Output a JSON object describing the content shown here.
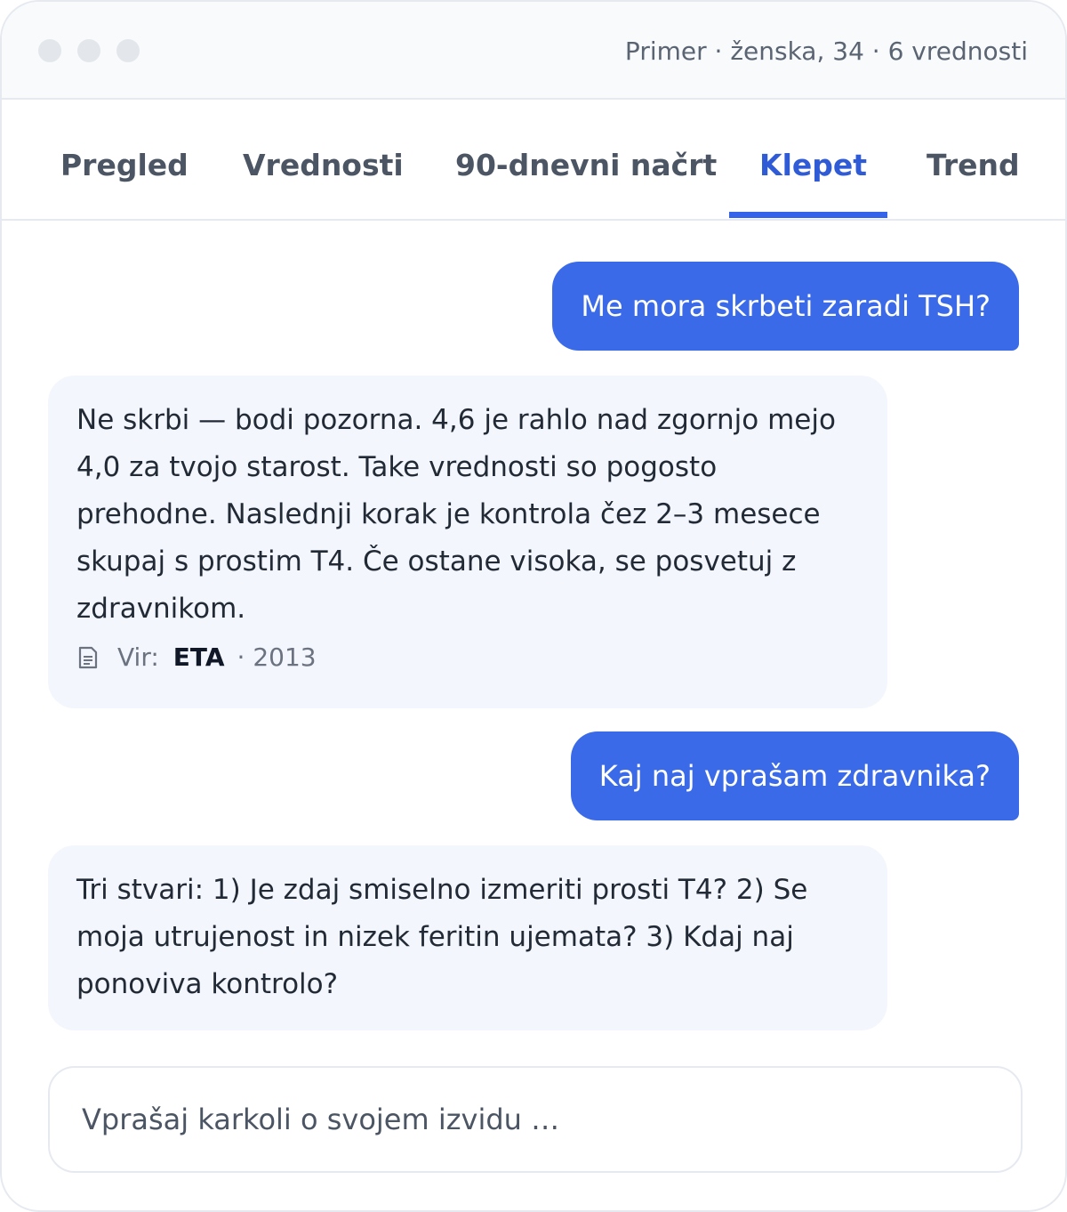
{
  "header": {
    "meta": "Primer · ženska, 34 · 6 vrednosti"
  },
  "tabs": [
    {
      "label": "Pregled",
      "active": false
    },
    {
      "label": "Vrednosti",
      "active": false
    },
    {
      "label": "90-dnevni načrt",
      "active": false
    },
    {
      "label": "Klepet",
      "active": true
    },
    {
      "label": "Trend",
      "active": false
    }
  ],
  "messages": [
    {
      "role": "user",
      "text": "Me mora skrbeti zaradi TSH?"
    },
    {
      "role": "assistant",
      "text": "Ne skrbi — bodi pozorna. 4,6 je rahlo nad zgornjo mejo 4,0 za tvojo starost. Take vrednosti so pogosto prehodne. Naslednji korak je kontrola čez 2–3 mesece skupaj s prostim T4. Če ostane visoka, se posvetuj z zdravnikom.",
      "source": {
        "label": "Vir:",
        "name": "ETA",
        "year": "· 2013",
        "icon": "document-icon"
      }
    },
    {
      "role": "user",
      "text": "Kaj naj vprašam zdravnika?"
    },
    {
      "role": "assistant",
      "text": "Tri stvari: 1) Je zdaj smiselno izmeriti prosti T4? 2) Se moja utrujenost in nizek feritin ujemata? 3) Kdaj naj ponoviva kontrolo?"
    }
  ],
  "composer": {
    "placeholder": "Vprašaj karkoli o svojem izvidu …"
  },
  "colors": {
    "accent": "#3a6ae8",
    "active_tab": "#2f5bd6",
    "bot_bubble": "#f3f6fc"
  }
}
